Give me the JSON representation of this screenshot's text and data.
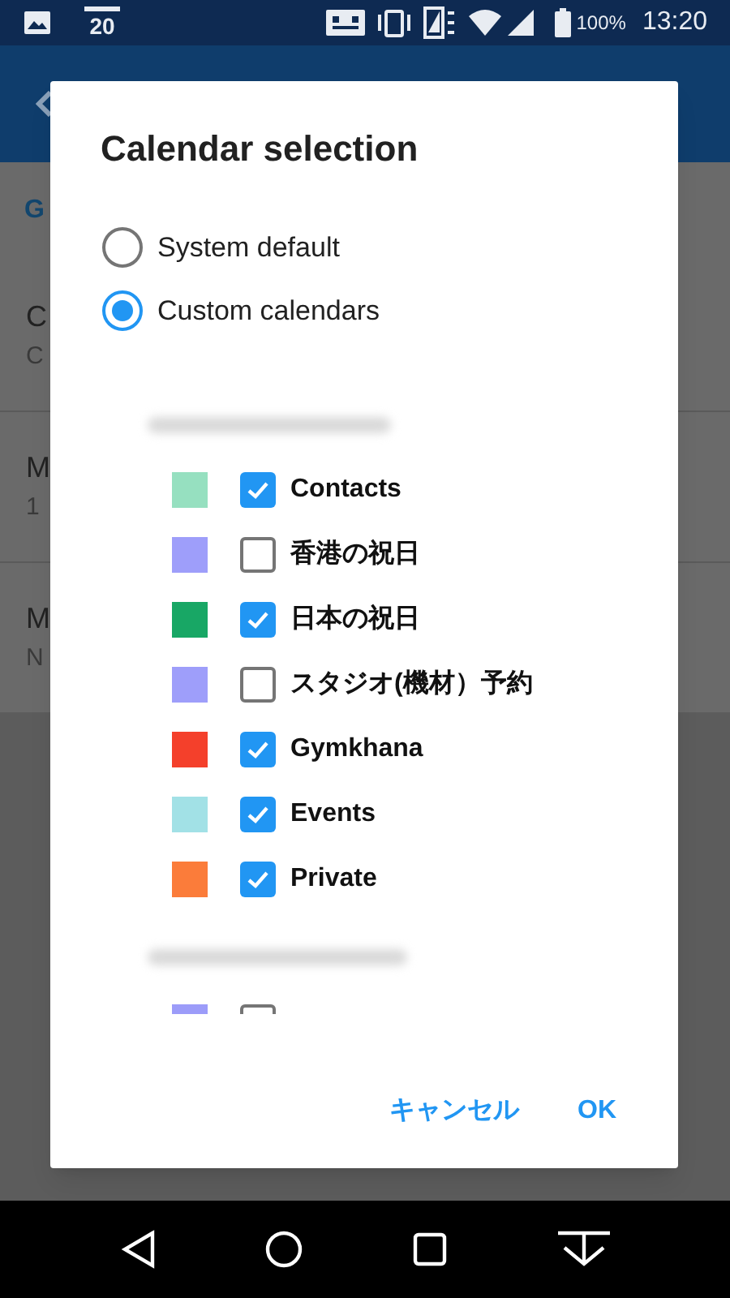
{
  "status_bar": {
    "calendar_day": "20",
    "battery": "100%",
    "time": "13:20"
  },
  "background": {
    "section_header": "G",
    "rows": [
      {
        "title": "C",
        "subtitle": "C"
      },
      {
        "title": "M",
        "subtitle": "1"
      },
      {
        "title": "M",
        "subtitle": "N"
      }
    ]
  },
  "dialog": {
    "title": "Calendar selection",
    "options": [
      {
        "label": "System default",
        "selected": false
      },
      {
        "label": "Custom calendars",
        "selected": true
      }
    ],
    "accounts": [
      {
        "calendars": [
          {
            "label": "Contacts",
            "color": "#96e0c0",
            "checked": true
          },
          {
            "label": "香港の祝日",
            "color": "#9e9efa",
            "checked": false
          },
          {
            "label": "日本の祝日",
            "color": "#18a765",
            "checked": true
          },
          {
            "label": "スタジオ(機材）予約",
            "color": "#9e9efa",
            "checked": false
          },
          {
            "label": "Gymkhana",
            "color": "#f4402b",
            "checked": true
          },
          {
            "label": "Events",
            "color": "#a2e1e6",
            "checked": true
          },
          {
            "label": "Private",
            "color": "#fb7c3a",
            "checked": true
          }
        ]
      },
      {
        "calendars": [
          {
            "color": "#9c9cf9",
            "checked": false
          }
        ]
      }
    ],
    "buttons": [
      {
        "label": "キャンセル"
      },
      {
        "label": "OK"
      }
    ]
  }
}
